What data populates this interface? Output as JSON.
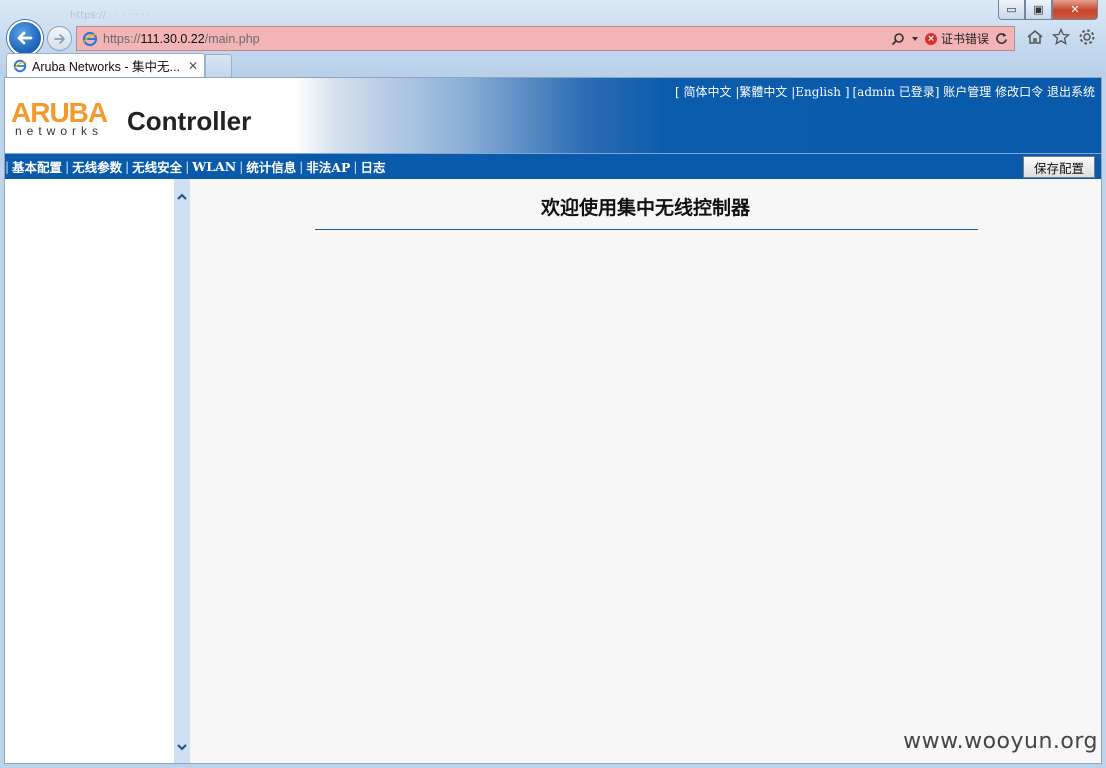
{
  "browser": {
    "window_controls": {
      "minimize": "▭",
      "restore": "▣",
      "close": "✕"
    },
    "address": {
      "scheme": "https://",
      "host": "111.30.0.22",
      "path": "/main.php",
      "certificate_error": "证书错误"
    },
    "tab": {
      "title": "Aruba Networks - 集中无...",
      "close": "✕"
    },
    "icons": [
      "home-icon",
      "favorites-star-icon",
      "settings-gear-icon"
    ]
  },
  "header": {
    "logo_brand": "ARUBA",
    "logo_sub": "networks",
    "logo_product": "Controller",
    "languages": {
      "open": "[",
      "simplified": "简体中文",
      "traditional": "繁體中文",
      "english": "English",
      "close": "]",
      "sep": "|"
    },
    "user": {
      "status": "[admin 已登录]",
      "account": "账户管理",
      "change_password": "修改口令",
      "logout": "退出系统"
    }
  },
  "menu": {
    "items": [
      "基本配置",
      "无线参数",
      "无线安全",
      "WLAN",
      "统计信息",
      "非法AP",
      "日志"
    ],
    "save_label": "保存配置"
  },
  "main": {
    "welcome": "欢迎使用集中无线控制器"
  },
  "watermark": "www.wooyun.org",
  "colors": {
    "header_blue": "#0a5aab",
    "logo_orange": "#f29a2e",
    "address_error_bg": "#f2b4b4"
  }
}
